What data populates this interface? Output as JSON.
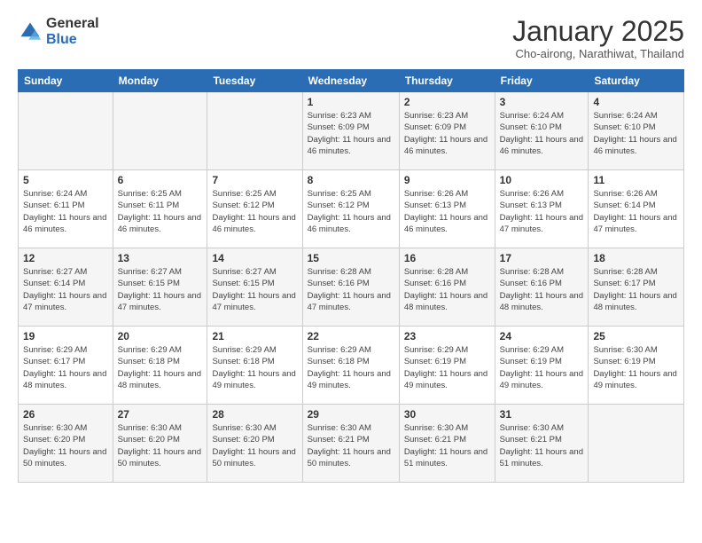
{
  "header": {
    "logo_general": "General",
    "logo_blue": "Blue",
    "month_title": "January 2025",
    "subtitle": "Cho-airong, Narathiwat, Thailand"
  },
  "calendar": {
    "days": [
      "Sunday",
      "Monday",
      "Tuesday",
      "Wednesday",
      "Thursday",
      "Friday",
      "Saturday"
    ],
    "weeks": [
      [
        {
          "day": "",
          "info": ""
        },
        {
          "day": "",
          "info": ""
        },
        {
          "day": "",
          "info": ""
        },
        {
          "day": "1",
          "info": "Sunrise: 6:23 AM\nSunset: 6:09 PM\nDaylight: 11 hours\nand 46 minutes."
        },
        {
          "day": "2",
          "info": "Sunrise: 6:23 AM\nSunset: 6:09 PM\nDaylight: 11 hours\nand 46 minutes."
        },
        {
          "day": "3",
          "info": "Sunrise: 6:24 AM\nSunset: 6:10 PM\nDaylight: 11 hours\nand 46 minutes."
        },
        {
          "day": "4",
          "info": "Sunrise: 6:24 AM\nSunset: 6:10 PM\nDaylight: 11 hours\nand 46 minutes."
        }
      ],
      [
        {
          "day": "5",
          "info": "Sunrise: 6:24 AM\nSunset: 6:11 PM\nDaylight: 11 hours\nand 46 minutes."
        },
        {
          "day": "6",
          "info": "Sunrise: 6:25 AM\nSunset: 6:11 PM\nDaylight: 11 hours\nand 46 minutes."
        },
        {
          "day": "7",
          "info": "Sunrise: 6:25 AM\nSunset: 6:12 PM\nDaylight: 11 hours\nand 46 minutes."
        },
        {
          "day": "8",
          "info": "Sunrise: 6:25 AM\nSunset: 6:12 PM\nDaylight: 11 hours\nand 46 minutes."
        },
        {
          "day": "9",
          "info": "Sunrise: 6:26 AM\nSunset: 6:13 PM\nDaylight: 11 hours\nand 46 minutes."
        },
        {
          "day": "10",
          "info": "Sunrise: 6:26 AM\nSunset: 6:13 PM\nDaylight: 11 hours\nand 47 minutes."
        },
        {
          "day": "11",
          "info": "Sunrise: 6:26 AM\nSunset: 6:14 PM\nDaylight: 11 hours\nand 47 minutes."
        }
      ],
      [
        {
          "day": "12",
          "info": "Sunrise: 6:27 AM\nSunset: 6:14 PM\nDaylight: 11 hours\nand 47 minutes."
        },
        {
          "day": "13",
          "info": "Sunrise: 6:27 AM\nSunset: 6:15 PM\nDaylight: 11 hours\nand 47 minutes."
        },
        {
          "day": "14",
          "info": "Sunrise: 6:27 AM\nSunset: 6:15 PM\nDaylight: 11 hours\nand 47 minutes."
        },
        {
          "day": "15",
          "info": "Sunrise: 6:28 AM\nSunset: 6:16 PM\nDaylight: 11 hours\nand 47 minutes."
        },
        {
          "day": "16",
          "info": "Sunrise: 6:28 AM\nSunset: 6:16 PM\nDaylight: 11 hours\nand 48 minutes."
        },
        {
          "day": "17",
          "info": "Sunrise: 6:28 AM\nSunset: 6:16 PM\nDaylight: 11 hours\nand 48 minutes."
        },
        {
          "day": "18",
          "info": "Sunrise: 6:28 AM\nSunset: 6:17 PM\nDaylight: 11 hours\nand 48 minutes."
        }
      ],
      [
        {
          "day": "19",
          "info": "Sunrise: 6:29 AM\nSunset: 6:17 PM\nDaylight: 11 hours\nand 48 minutes."
        },
        {
          "day": "20",
          "info": "Sunrise: 6:29 AM\nSunset: 6:18 PM\nDaylight: 11 hours\nand 48 minutes."
        },
        {
          "day": "21",
          "info": "Sunrise: 6:29 AM\nSunset: 6:18 PM\nDaylight: 11 hours\nand 49 minutes."
        },
        {
          "day": "22",
          "info": "Sunrise: 6:29 AM\nSunset: 6:18 PM\nDaylight: 11 hours\nand 49 minutes."
        },
        {
          "day": "23",
          "info": "Sunrise: 6:29 AM\nSunset: 6:19 PM\nDaylight: 11 hours\nand 49 minutes."
        },
        {
          "day": "24",
          "info": "Sunrise: 6:29 AM\nSunset: 6:19 PM\nDaylight: 11 hours\nand 49 minutes."
        },
        {
          "day": "25",
          "info": "Sunrise: 6:30 AM\nSunset: 6:19 PM\nDaylight: 11 hours\nand 49 minutes."
        }
      ],
      [
        {
          "day": "26",
          "info": "Sunrise: 6:30 AM\nSunset: 6:20 PM\nDaylight: 11 hours\nand 50 minutes."
        },
        {
          "day": "27",
          "info": "Sunrise: 6:30 AM\nSunset: 6:20 PM\nDaylight: 11 hours\nand 50 minutes."
        },
        {
          "day": "28",
          "info": "Sunrise: 6:30 AM\nSunset: 6:20 PM\nDaylight: 11 hours\nand 50 minutes."
        },
        {
          "day": "29",
          "info": "Sunrise: 6:30 AM\nSunset: 6:21 PM\nDaylight: 11 hours\nand 50 minutes."
        },
        {
          "day": "30",
          "info": "Sunrise: 6:30 AM\nSunset: 6:21 PM\nDaylight: 11 hours\nand 51 minutes."
        },
        {
          "day": "31",
          "info": "Sunrise: 6:30 AM\nSunset: 6:21 PM\nDaylight: 11 hours\nand 51 minutes."
        },
        {
          "day": "",
          "info": ""
        }
      ]
    ]
  }
}
